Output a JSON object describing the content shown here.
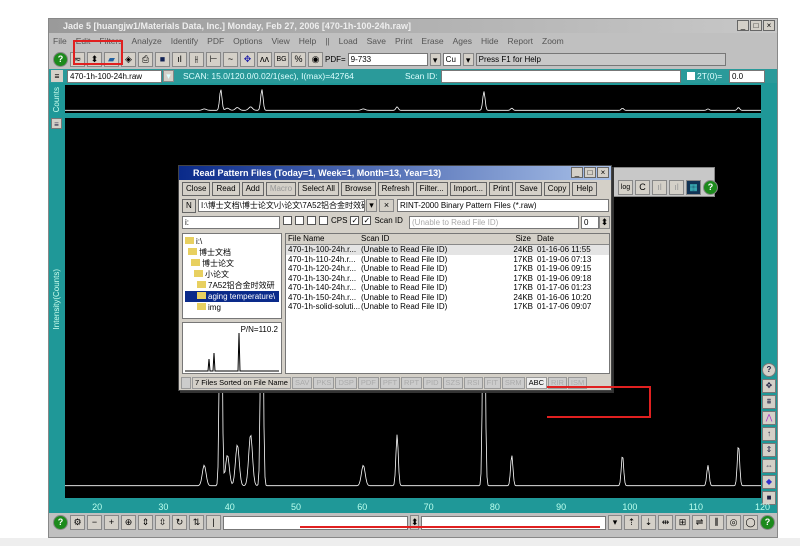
{
  "window": {
    "title": "Jade 5 [huangjw1/Materials Data, Inc.] Monday, Feb 27, 2006 [470-1h-100-24h.raw]",
    "buttons": [
      "_",
      "□",
      "×"
    ]
  },
  "menu": [
    "File",
    "Edit",
    "Filters",
    "Analyze",
    "Identify",
    "PDF",
    "Options",
    "View",
    "Help",
    "||",
    "Load",
    "Save",
    "Print",
    "Erase",
    "Ages",
    "Hide",
    "Report",
    "Zoom"
  ],
  "toolbar": {
    "pdf_label": "PDF=",
    "pdf_value": "9-733",
    "radiation": "Cu",
    "help_text": "Press F1 for Help"
  },
  "scanbar": {
    "file": "470-1h-100-24h.raw",
    "scan_info": "SCAN: 15.0/120.0/0.02/1(sec), I(max)=42764",
    "scan_id_label": "Scan ID:",
    "two_theta_label": "2T(0)=",
    "two_theta_value": "0.0"
  },
  "plot": {
    "top_ylabel": "Counts",
    "ylabel": "Intensity(Counts)",
    "x_ticks": [
      "20",
      "30",
      "40",
      "50",
      "60",
      "70",
      "80",
      "90",
      "100",
      "110",
      "120"
    ],
    "peaks_2theta": [
      38.5,
      44.7,
      65.1,
      78.2,
      82.4,
      99.1,
      112.0,
      116.6
    ]
  },
  "dialog": {
    "title": "Read Pattern Files (Today=1, Week=1, Month=13, Year=13)",
    "buttons": [
      {
        "label": "Close",
        "enabled": true
      },
      {
        "label": "Read",
        "enabled": true
      },
      {
        "label": "Add",
        "enabled": true
      },
      {
        "label": "Macro",
        "enabled": false
      },
      {
        "label": "Select All",
        "enabled": true
      },
      {
        "label": "Browse",
        "enabled": true
      },
      {
        "label": "Refresh",
        "enabled": true
      },
      {
        "label": "Filter...",
        "enabled": true
      },
      {
        "label": "Import...",
        "enabled": true
      },
      {
        "label": "Print",
        "enabled": true
      },
      {
        "label": "Save",
        "enabled": true
      },
      {
        "label": "Copy",
        "enabled": true
      },
      {
        "label": "Help",
        "enabled": true
      }
    ],
    "n_label": "N",
    "path": "I:\\博士文档\\博士论文\\小论文\\7A52铝合金时效研",
    "file_type": "RINT-2000 Binary Pattern Files (*.raw)",
    "drive": "i:",
    "cps_label": "CPS",
    "scanid_label": "Scan ID",
    "scanid_value": "(Unable to Read File ID)",
    "spin_value": "0",
    "tree": [
      {
        "label": "i:\\",
        "selected": false
      },
      {
        "label": "博士文档",
        "selected": false
      },
      {
        "label": "博士论文",
        "selected": false
      },
      {
        "label": "小论文",
        "selected": false
      },
      {
        "label": "7A52铝合金时效研",
        "selected": false
      },
      {
        "label": "aging temperature\\",
        "selected": true
      },
      {
        "label": "img",
        "selected": false
      }
    ],
    "preview_label": "P/N=110.2",
    "columns": [
      "File Name",
      "Scan ID",
      "Size",
      "Date"
    ],
    "files": [
      [
        "470-1h-100-24h.r...",
        "(Unable to Read File ID)",
        "24KB",
        "01-16-06 11:55"
      ],
      [
        "470-1h-110-24h.r...",
        "(Unable to Read File ID)",
        "17KB",
        "01-19-06 07:13"
      ],
      [
        "470-1h-120-24h.r...",
        "(Unable to Read File ID)",
        "17KB",
        "01-19-06 09:15"
      ],
      [
        "470-1h-130-24h.r...",
        "(Unable to Read File ID)",
        "17KB",
        "01-19-06 09:18"
      ],
      [
        "470-1h-140-24h.r...",
        "(Unable to Read File ID)",
        "17KB",
        "01-17-06 01:23"
      ],
      [
        "470-1h-150-24h.r...",
        "(Unable to Read File ID)",
        "24KB",
        "01-16-06 10:20"
      ],
      [
        "470-1h-solid-soluti...",
        "(Unable to Read File ID)",
        "17KB",
        "01-17-06 09:07"
      ]
    ],
    "status": "7 Files Sorted on File Name",
    "tabs": [
      "SAV",
      "PKS",
      "DSP",
      "PDF",
      "PFT",
      "RPT",
      "PID",
      "SZS",
      "RSI",
      "FIT",
      "SRM",
      "ABC",
      "RIR",
      "ISM"
    ],
    "active_tab": "ABC"
  },
  "colors": {
    "teal": "#1f9898",
    "plot_bg": "#000000",
    "trace": "#ffffff",
    "annotation": "#e02020"
  }
}
